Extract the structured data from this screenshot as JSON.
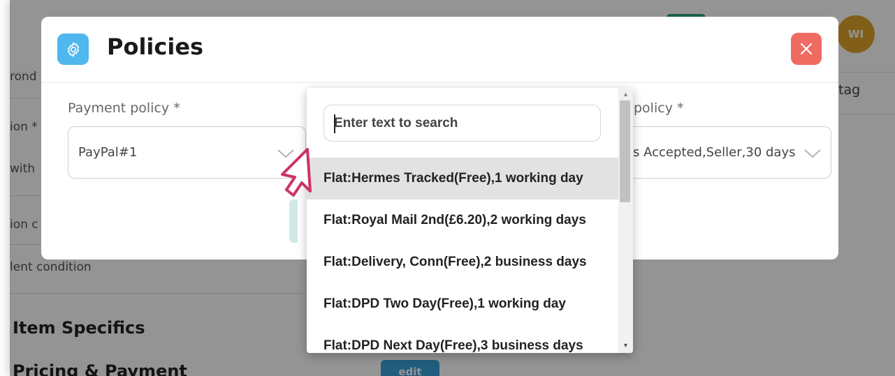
{
  "background": {
    "heading_item_specifics": "Item Specifics",
    "heading_pricing": "Pricing & Payment",
    "edit_label": "edit",
    "condition_text": "lent condition",
    "frag_top": "rond",
    "frag_ion_star": "ion *",
    "frag_with": "with",
    "frag_ion_c": "ion c",
    "tag_label": "tag",
    "avatar_initials": "WI"
  },
  "modal": {
    "title": "Policies",
    "icon": "gear-icon",
    "close_icon": "close-icon",
    "payment_policy": {
      "label": "Payment policy *",
      "value": "PayPal#1"
    },
    "return_policy": {
      "label": "policy *",
      "value": "s Accepted,Seller,30 days"
    }
  },
  "dropdown": {
    "search_placeholder": "Enter text to search",
    "search_value": "",
    "options": [
      {
        "label": "Flat:Hermes Tracked(Free),1 working day",
        "selected": true
      },
      {
        "label": "Flat:Royal Mail 2nd(£6.20),2 working days",
        "selected": false
      },
      {
        "label": "Flat:Delivery, Conn(Free),2 business days",
        "selected": false
      },
      {
        "label": "Flat:DPD Two Day(Free),1 working day",
        "selected": false
      },
      {
        "label": "Flat:DPD Next Day(Free),3 business days",
        "selected": false
      }
    ]
  },
  "colors": {
    "overlay": "#6b6b6b",
    "gear_bg": "#4fb6ee",
    "close_bg": "#ef6b62",
    "selected_option_bg": "#e2e2e2",
    "cursor_stroke": "#cc3366"
  }
}
